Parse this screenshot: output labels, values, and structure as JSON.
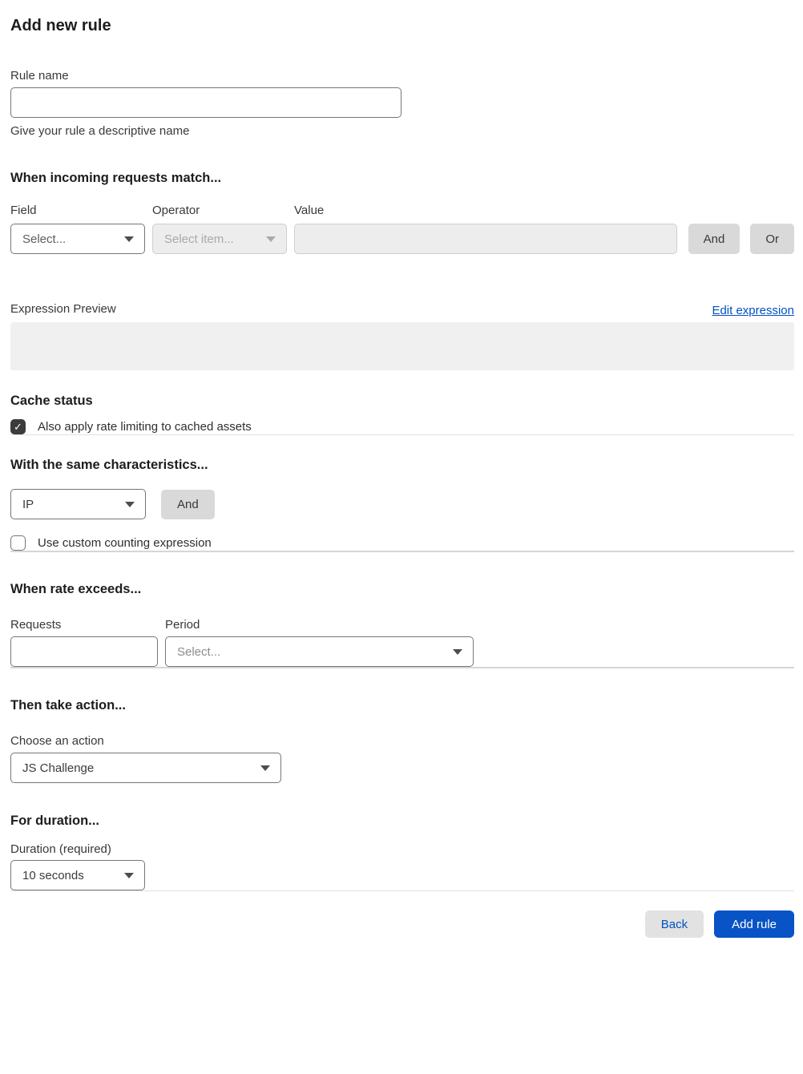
{
  "page": {
    "title": "Add new rule"
  },
  "rule_name": {
    "label": "Rule name",
    "value": "",
    "helper": "Give your rule a descriptive name"
  },
  "match_section": {
    "heading": "When incoming requests match...",
    "field_label": "Field",
    "operator_label": "Operator",
    "value_label": "Value",
    "field_selected": "Select...",
    "operator_selected": "Select item...",
    "value_value": "",
    "and_button": "And",
    "or_button": "Or",
    "expression_preview_label": "Expression Preview",
    "edit_expression_link": "Edit expression",
    "expression_preview_value": ""
  },
  "cache_section": {
    "heading": "Cache status",
    "checkbox_label": "Also apply rate limiting to cached assets",
    "checkbox_checked": true
  },
  "characteristics_section": {
    "heading": "With the same characteristics...",
    "characteristic_selected": "IP",
    "and_button": "And",
    "checkbox_label": "Use custom counting expression",
    "checkbox_checked": false
  },
  "rate_section": {
    "heading": "When rate exceeds...",
    "requests_label": "Requests",
    "requests_value": "",
    "period_label": "Period",
    "period_selected": "Select..."
  },
  "action_section": {
    "heading": "Then take action...",
    "label": "Choose an action",
    "action_selected": "JS Challenge"
  },
  "duration_section": {
    "heading": "For duration...",
    "label": "Duration (required)",
    "duration_selected": "10 seconds"
  },
  "footer": {
    "back_button": "Back",
    "add_rule_button": "Add rule"
  },
  "icons": {
    "dropdown_caret": "chevron-down-icon",
    "checkmark": "✓"
  },
  "colors": {
    "accent_blue": "#0051c3",
    "primary_button_bg": "#0853c5",
    "checked_checkbox": "#3c3c3c",
    "disabled_bg": "#ededed",
    "preview_box_bg": "#f0f0f0",
    "gray_button_bg": "#d9d9d9"
  }
}
